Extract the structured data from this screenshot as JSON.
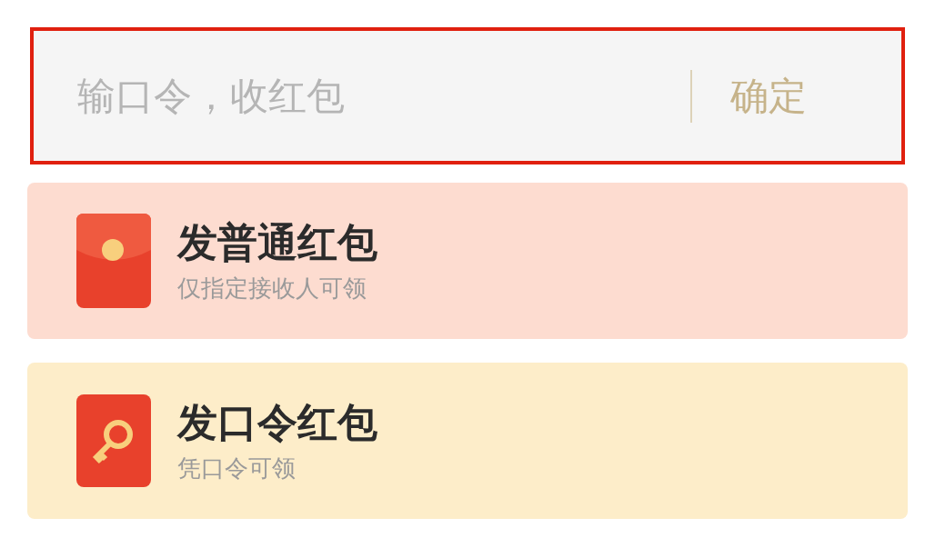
{
  "password_field": {
    "placeholder": "输口令，收红包",
    "confirm_button": "确定"
  },
  "options": [
    {
      "kind": "envelope",
      "title": "发普通红包",
      "subtitle": "仅指定接收人可领",
      "color": "#fddcd0"
    },
    {
      "kind": "key",
      "title": "发口令红包",
      "subtitle": "凭口令可领",
      "color": "#fdedc9"
    }
  ]
}
